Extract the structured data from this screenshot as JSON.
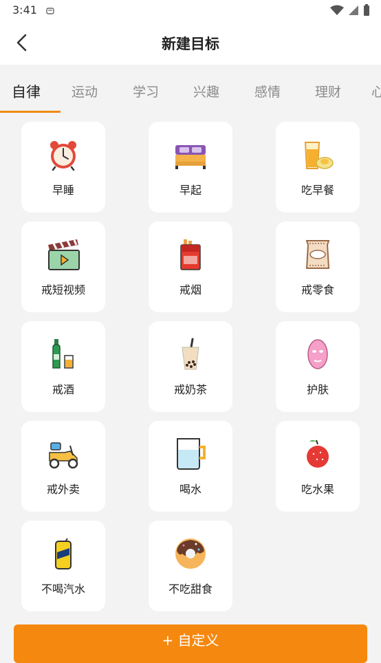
{
  "status": {
    "time": "3:41"
  },
  "header": {
    "title": "新建目标",
    "back_icon": "chevron-left-icon"
  },
  "tabs": [
    {
      "label": "自律",
      "active": true
    },
    {
      "label": "运动"
    },
    {
      "label": "学习"
    },
    {
      "label": "兴趣"
    },
    {
      "label": "感情"
    },
    {
      "label": "理财"
    },
    {
      "label": "心"
    }
  ],
  "goals": [
    {
      "label": "早睡",
      "icon": "alarm-clock-icon"
    },
    {
      "label": "早起",
      "icon": "bed-icon"
    },
    {
      "label": "吃早餐",
      "icon": "breakfast-icon"
    },
    {
      "label": "戒短视频",
      "icon": "clapperboard-icon"
    },
    {
      "label": "戒烟",
      "icon": "cigarette-pack-icon"
    },
    {
      "label": "戒零食",
      "icon": "snack-bag-icon"
    },
    {
      "label": "戒酒",
      "icon": "liquor-icon"
    },
    {
      "label": "戒奶茶",
      "icon": "milk-tea-icon"
    },
    {
      "label": "护肤",
      "icon": "face-mask-icon"
    },
    {
      "label": "戒外卖",
      "icon": "delivery-scooter-icon"
    },
    {
      "label": "喝水",
      "icon": "water-cup-icon"
    },
    {
      "label": "吃水果",
      "icon": "apple-icon"
    },
    {
      "label": "不喝汽水",
      "icon": "soda-can-icon"
    },
    {
      "label": "不吃甜食",
      "icon": "donut-icon"
    }
  ],
  "custom_button": {
    "label": "+  自定义"
  },
  "colors": {
    "accent": "#f5880f",
    "tab_underline": "#f08a10",
    "background": "#f3f3f3"
  }
}
